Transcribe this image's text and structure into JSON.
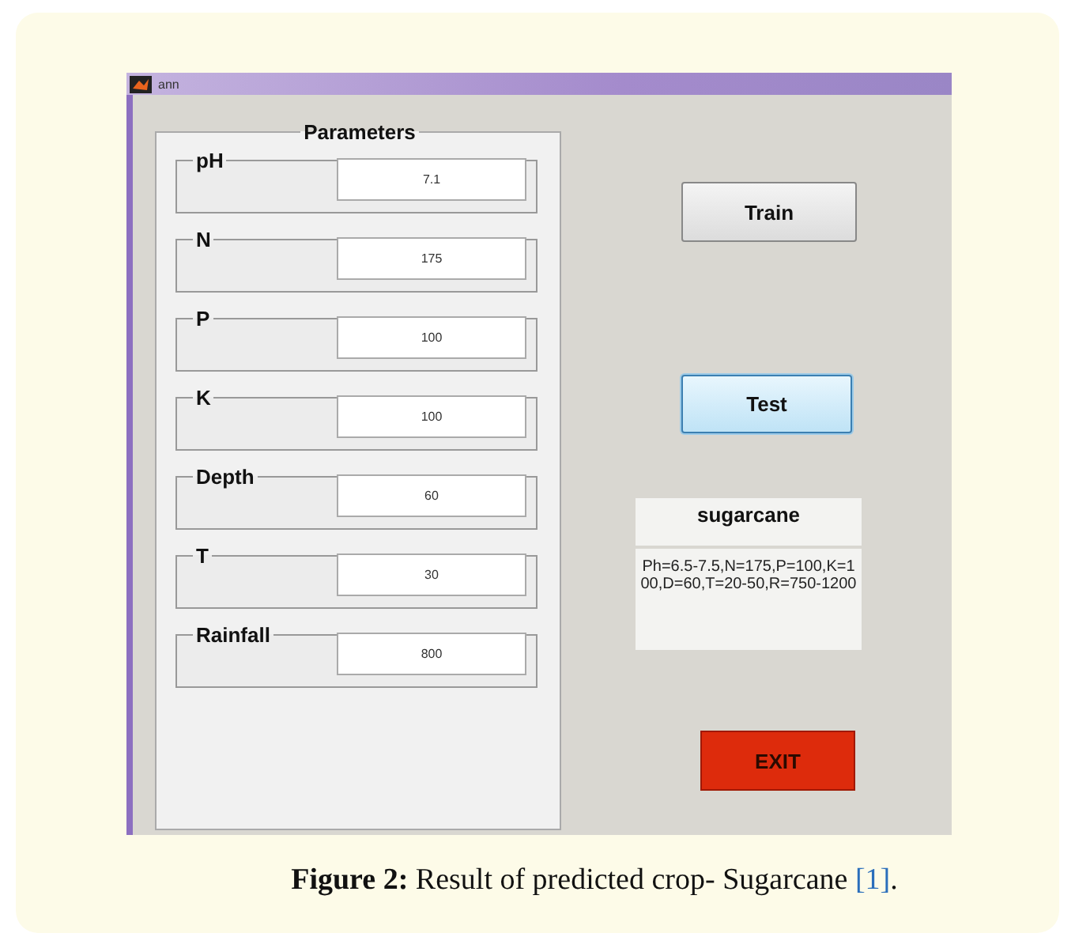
{
  "window": {
    "title": "ann"
  },
  "parameters": {
    "title": "Parameters",
    "fields": [
      {
        "label": "pH",
        "value": "7.1"
      },
      {
        "label": "N",
        "value": "175"
      },
      {
        "label": "P",
        "value": "100"
      },
      {
        "label": "K",
        "value": "100"
      },
      {
        "label": "Depth",
        "value": "60"
      },
      {
        "label": "T",
        "value": "30"
      },
      {
        "label": "Rainfall",
        "value": "800"
      }
    ]
  },
  "train_button": {
    "label": "Train",
    "kind": "normal",
    "focused": false
  },
  "test_button": {
    "label": "Test",
    "kind": "normal",
    "focused": true
  },
  "result": {
    "crop": "sugarcane",
    "details": "Ph=6.5-7.5,N=175,P=100,K=100,D=60,T=20-50,R=750-1200"
  },
  "exit_button": {
    "label": "EXIT",
    "kind": "danger",
    "focused": false
  },
  "caption": {
    "text": "**Figure 2:** Result of predicted crop- Sugarcane ",
    "reference": "[1]",
    "end": "."
  }
}
